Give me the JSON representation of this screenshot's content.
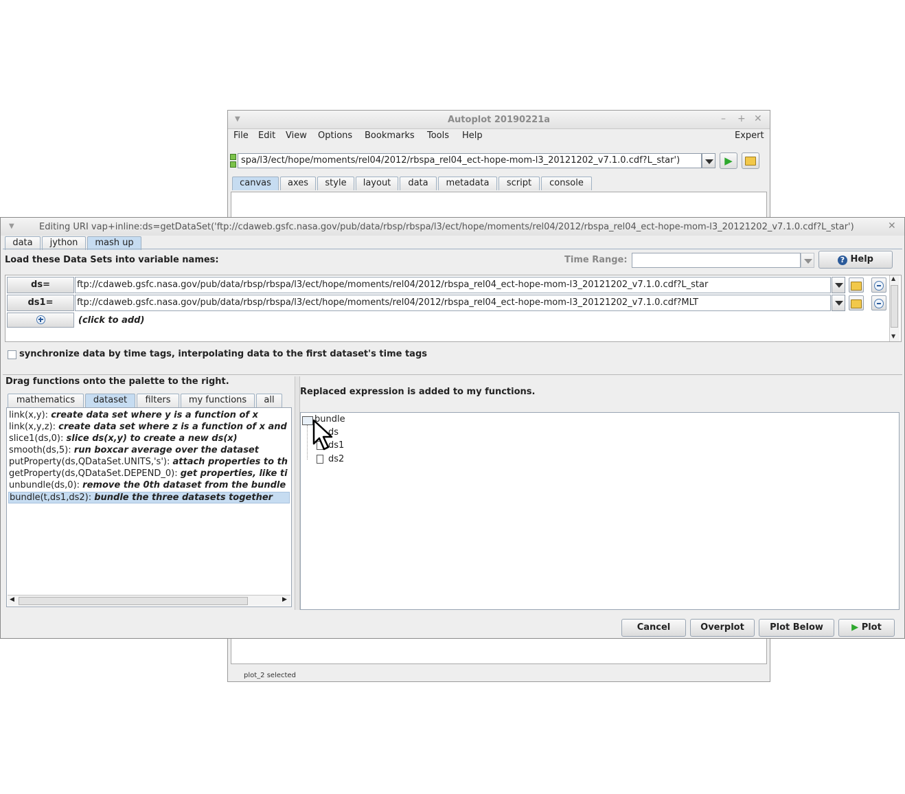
{
  "main_window": {
    "title": "Autoplot 20190221a",
    "menus": [
      "File",
      "Edit",
      "View",
      "Options",
      "Bookmarks",
      "Tools",
      "Help"
    ],
    "expert_label": "Expert",
    "url_value": "spa/l3/ect/hope/moments/rel04/2012/rbspa_rel04_ect-hope-mom-l3_20121202_v7.1.0.cdf?L_star')",
    "tabs": [
      "canvas",
      "axes",
      "style",
      "layout",
      "data",
      "metadata",
      "script",
      "console"
    ],
    "status": "plot_2 selected"
  },
  "editor": {
    "title": "Editing URI vap+inline:ds=getDataSet('ftp://cdaweb.gsfc.nasa.gov/pub/data/rbsp/rbspa/l3/ect/hope/moments/rel04/2012/rbspa_rel04_ect-hope-mom-l3_20121202_v7.1.0.cdf?L_star')",
    "tabs": [
      "data",
      "jython",
      "mash up"
    ],
    "load_label": "Load these Data Sets into variable names:",
    "time_range_label": "Time Range:",
    "time_range_value": "",
    "help_label": "Help",
    "rows": [
      {
        "name": "ds=",
        "uri": "ftp://cdaweb.gsfc.nasa.gov/pub/data/rbsp/rbspa/l3/ect/hope/moments/rel04/2012/rbspa_rel04_ect-hope-mom-l3_20121202_v7.1.0.cdf?L_star"
      },
      {
        "name": "ds1=",
        "uri": "ftp://cdaweb.gsfc.nasa.gov/pub/data/rbsp/rbspa/l3/ect/hope/moments/rel04/2012/rbspa_rel04_ect-hope-mom-l3_20121202_v7.1.0.cdf?MLT"
      }
    ],
    "click_to_add": "(click to add)",
    "sync_label": "synchronize data by time tags, interpolating data to the first dataset's time tags",
    "drag_label": "Drag functions onto the palette to the right.",
    "function_tabs": [
      "mathematics",
      "dataset",
      "filters",
      "my functions",
      "all"
    ],
    "functions": [
      {
        "sig": "link(x,y):",
        "desc": "create data set where y is a function of x"
      },
      {
        "sig": "link(x,y,z):",
        "desc": "create data set where z is a function of x and y"
      },
      {
        "sig": "slice1(ds,0):",
        "desc": "slice ds(x,y) to create a new ds(x)"
      },
      {
        "sig": "smooth(ds,5):",
        "desc": "run boxcar average over the dataset"
      },
      {
        "sig": "putProperty(ds,QDataSet.UNITS,'s'):",
        "desc": "attach properties to th"
      },
      {
        "sig": "getProperty(ds,QDataSet.DEPEND_0):",
        "desc": "get properties, like ti"
      },
      {
        "sig": "unbundle(ds,0):",
        "desc": "remove the 0th dataset from the bundle"
      },
      {
        "sig": "bundle(t,ds1,ds2):",
        "desc": "bundle the three datasets together"
      }
    ],
    "replaced_msg": "Replaced expression is added to my functions.",
    "tree": {
      "root": "bundle",
      "children": [
        "ds",
        "ds1",
        "ds2"
      ]
    },
    "buttons": {
      "cancel": "Cancel",
      "overplot": "Overplot",
      "plot_below": "Plot Below",
      "plot": "Plot"
    }
  }
}
